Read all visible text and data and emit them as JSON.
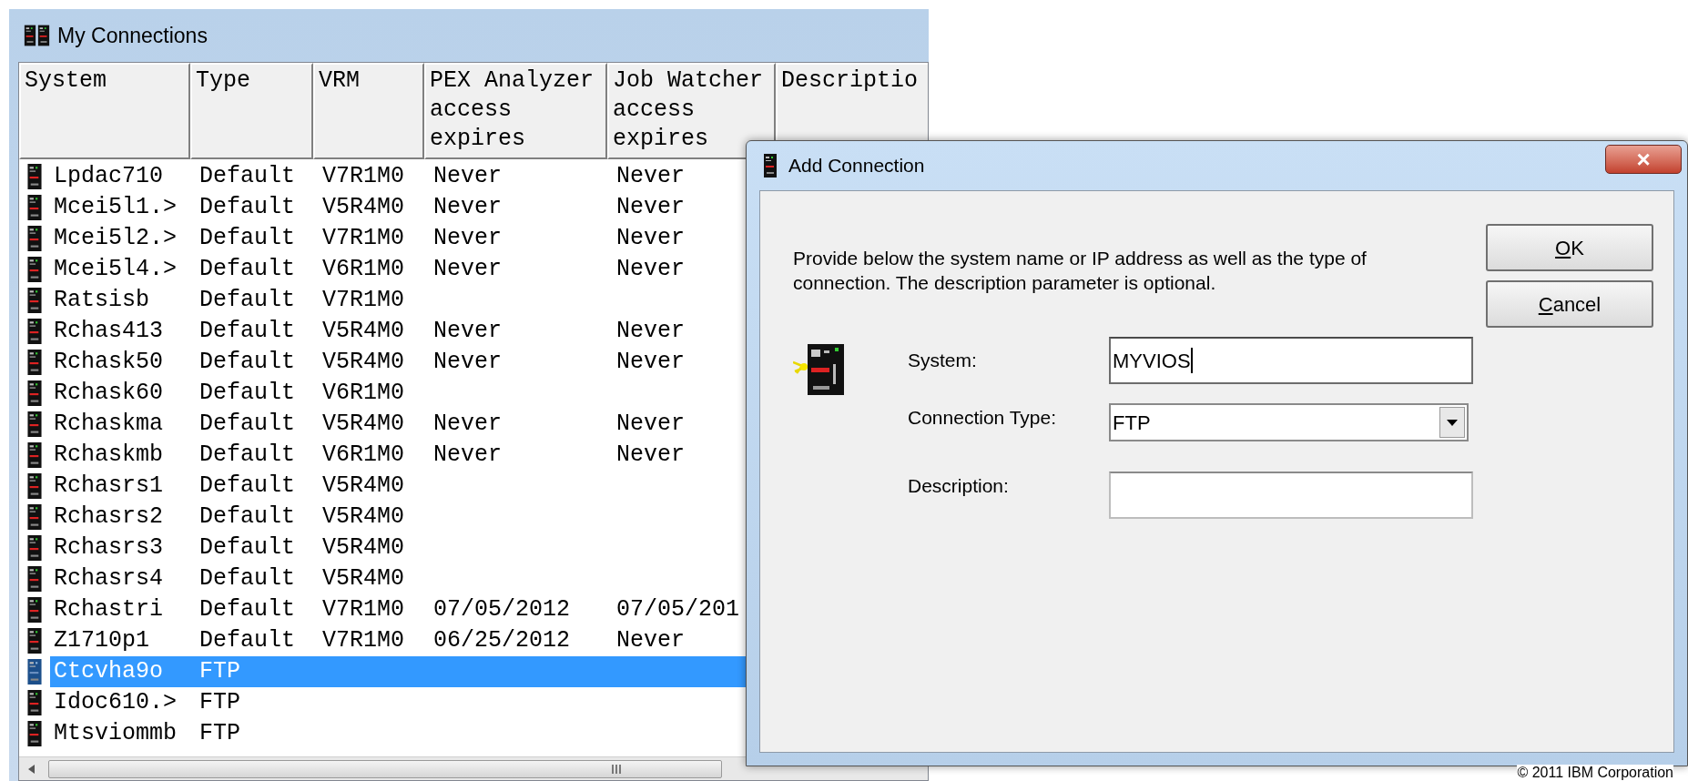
{
  "window": {
    "title": "My Connections"
  },
  "table": {
    "columns": [
      {
        "label": "System"
      },
      {
        "label": "Type"
      },
      {
        "label": "VRM"
      },
      {
        "label": "PEX Analyzer access expires"
      },
      {
        "label": "Job Watcher access expires"
      },
      {
        "label": "Descriptio"
      }
    ],
    "rows": [
      {
        "system": "Lpdac710",
        "type": "Default",
        "vrm": "V7R1M0",
        "pex": "Never",
        "job": "Never",
        "selected": false
      },
      {
        "system": "Mcei5l1.>",
        "type": "Default",
        "vrm": "V5R4M0",
        "pex": "Never",
        "job": "Never",
        "selected": false
      },
      {
        "system": "Mcei5l2.>",
        "type": "Default",
        "vrm": "V7R1M0",
        "pex": "Never",
        "job": "Never",
        "selected": false
      },
      {
        "system": "Mcei5l4.>",
        "type": "Default",
        "vrm": "V6R1M0",
        "pex": "Never",
        "job": "Never",
        "selected": false
      },
      {
        "system": "Ratsisb",
        "type": "Default",
        "vrm": "V7R1M0",
        "selected": false
      },
      {
        "system": "Rchas413",
        "type": "Default",
        "vrm": "V5R4M0",
        "pex": "Never",
        "job": "Never",
        "selected": false
      },
      {
        "system": "Rchask50",
        "type": "Default",
        "vrm": "V5R4M0",
        "pex": "Never",
        "job": "Never",
        "selected": false
      },
      {
        "system": "Rchask60",
        "type": "Default",
        "vrm": "V6R1M0",
        "selected": false
      },
      {
        "system": "Rchaskma",
        "type": "Default",
        "vrm": "V5R4M0",
        "pex": "Never",
        "job": "Never",
        "selected": false
      },
      {
        "system": "Rchaskmb",
        "type": "Default",
        "vrm": "V6R1M0",
        "pex": "Never",
        "job": "Never",
        "selected": false
      },
      {
        "system": "Rchasrs1",
        "type": "Default",
        "vrm": "V5R4M0",
        "selected": false
      },
      {
        "system": "Rchasrs2",
        "type": "Default",
        "vrm": "V5R4M0",
        "selected": false
      },
      {
        "system": "Rchasrs3",
        "type": "Default",
        "vrm": "V5R4M0",
        "selected": false
      },
      {
        "system": "Rchasrs4",
        "type": "Default",
        "vrm": "V5R4M0",
        "selected": false
      },
      {
        "system": "Rchastri",
        "type": "Default",
        "vrm": "V7R1M0",
        "pex": "07/05/2012",
        "job": "07/05/201",
        "selected": false
      },
      {
        "system": "Z1710p1",
        "type": "Default",
        "vrm": "V7R1M0",
        "pex": "06/25/2012",
        "job": "Never",
        "selected": false
      },
      {
        "system": "Ctcvha9o",
        "type": "FTP",
        "selected": true
      },
      {
        "system": "Idoc610.>",
        "type": "FTP",
        "selected": false
      },
      {
        "system": "Mtsviommb",
        "type": "FTP",
        "selected": false
      }
    ]
  },
  "dialog": {
    "title": "Add Connection",
    "close": "×",
    "message": "Provide below the system name or IP address as well as the type of connection.  The description parameter is optional.",
    "buttons": [
      {
        "label": "OK",
        "underline_first": true
      },
      {
        "label": "Cancel",
        "underline_first": true
      }
    ],
    "fields": [
      {
        "kind": "text",
        "label": "System:",
        "value": "MYVIOS",
        "focused": true
      },
      {
        "kind": "dropdown",
        "label": "Connection Type:",
        "value": "FTP"
      },
      {
        "kind": "text",
        "label": "Description:",
        "focused": false
      }
    ]
  },
  "footer": "© 2011 IBM Corporation"
}
